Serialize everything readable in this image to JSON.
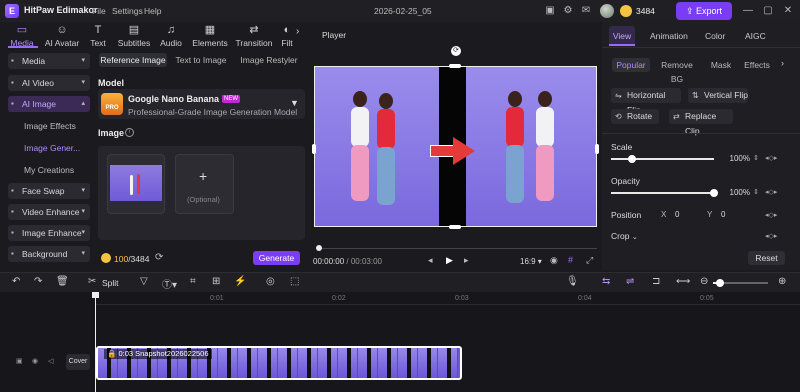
{
  "app": {
    "name": "HitPaw Edimakor",
    "logo_letter": "E",
    "project": "2026-02-25_05",
    "credits": "3484",
    "export_label": "Export"
  },
  "menu": [
    "File",
    "Settings",
    "Help"
  ],
  "media_tabs": [
    {
      "label": "Media",
      "icon": "▭"
    },
    {
      "label": "AI Avatar",
      "icon": "☺"
    },
    {
      "label": "Text",
      "icon": "T"
    },
    {
      "label": "Subtitles",
      "icon": "▤"
    },
    {
      "label": "Audio",
      "icon": "♫"
    },
    {
      "label": "Elements",
      "icon": "▦"
    },
    {
      "label": "Transition",
      "icon": "⇄"
    },
    {
      "label": "Filt",
      "icon": "◐"
    }
  ],
  "sidebar": {
    "items": [
      {
        "label": "Media"
      },
      {
        "label": "AI Video"
      },
      {
        "label": "AI Image"
      },
      {
        "label": "Face Swap"
      },
      {
        "label": "Video Enhance"
      },
      {
        "label": "Image Enhance"
      },
      {
        "label": "Background"
      }
    ],
    "subitems": [
      "Image Effects",
      "Image Gener...",
      "My Creations"
    ]
  },
  "ai_image": {
    "tabs": [
      "Reference Image",
      "Text to Image",
      "Image Restyler"
    ],
    "model_heading": "Model",
    "model_name": "Google Nano Banana Pro",
    "model_badge": "NEW",
    "model_icon_text": "PRO",
    "model_desc": "Professional-Grade Image Generation Model",
    "image_heading": "Image",
    "info_icon": "i",
    "optional_label": "(Optional)",
    "plus": "+",
    "credits_used": "100",
    "credits_total": "/3484",
    "generate_label": "Generate"
  },
  "player": {
    "title": "Player",
    "time_current": "00:00:00",
    "time_total": "/ 00:03:00",
    "ratio": "16:9"
  },
  "properties": {
    "tabs": [
      "View",
      "Animation",
      "Color",
      "AIGC"
    ],
    "subtabs": [
      "Popular",
      "Remove BG",
      "Mask",
      "Effects"
    ],
    "buttons": [
      "Horizontal Flip",
      "Vertical Flip",
      "Rotate",
      "Replace Clip"
    ],
    "scale_label": "Scale",
    "scale_value": "100%",
    "scale_level": 0.2,
    "opacity_label": "Opacity",
    "opacity_value": "100%",
    "opacity_level": 1,
    "position_label": "Position",
    "pos_x_label": "X",
    "pos_x": "0",
    "pos_y_label": "Y",
    "pos_y": "0",
    "crop_label": "Crop",
    "reset_label": "Reset"
  },
  "timeline": {
    "split_label": "Split",
    "ticks": [
      "0:01",
      "0:02",
      "0:03",
      "0:04",
      "0:05"
    ],
    "cover_label": "Cover",
    "clip_label": "0:03 Snapshot2026022506"
  }
}
